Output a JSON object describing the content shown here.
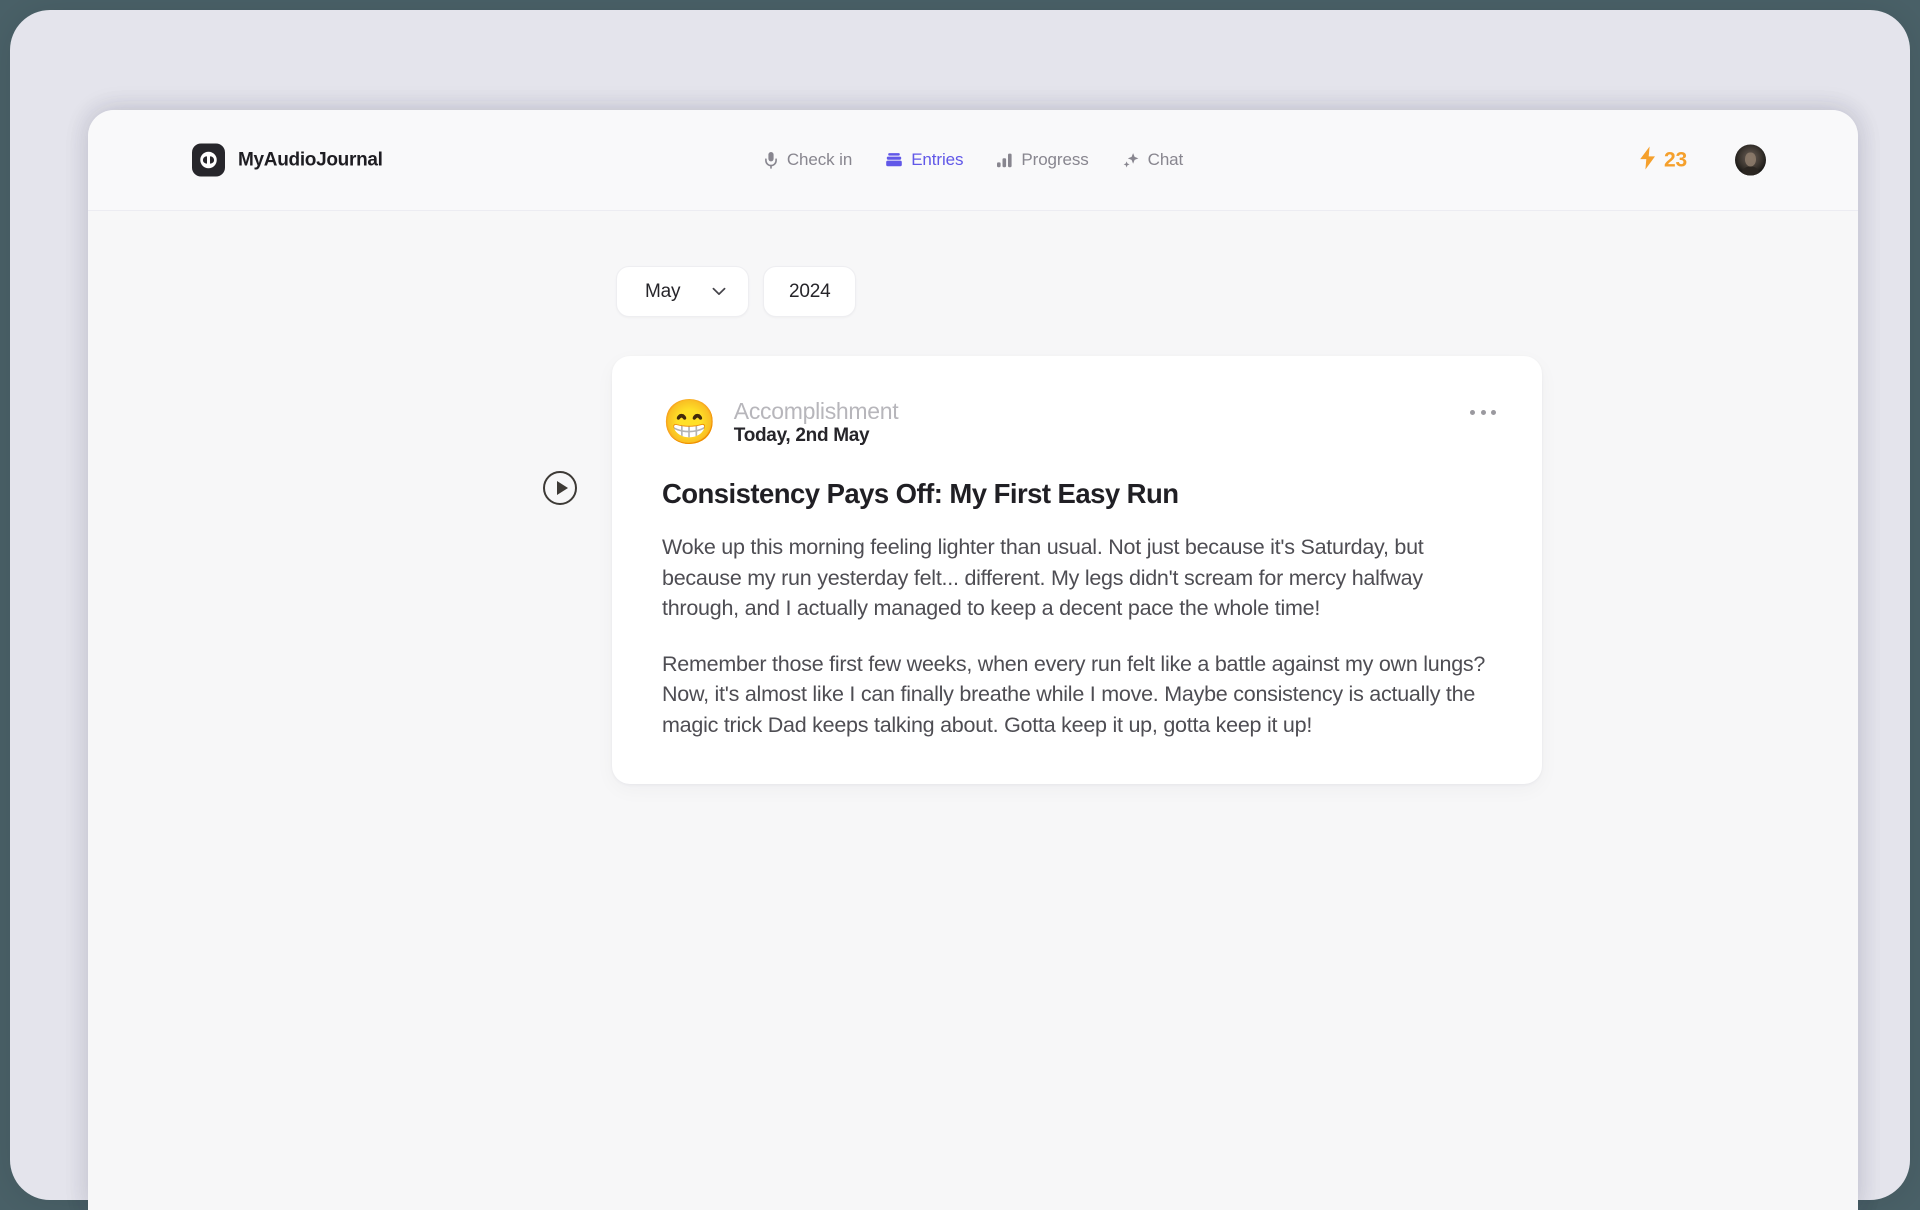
{
  "brand": {
    "name": "MyAudioJournal",
    "logo_icon": "audio-journal-logo-icon"
  },
  "nav": {
    "items": [
      {
        "label": "Check in",
        "icon": "microphone-icon",
        "active": false
      },
      {
        "label": "Entries",
        "icon": "book-stack-icon",
        "active": true
      },
      {
        "label": "Progress",
        "icon": "bar-chart-icon",
        "active": false
      },
      {
        "label": "Chat",
        "icon": "sparkles-icon",
        "active": false
      }
    ]
  },
  "topbar_right": {
    "streak_icon": "lightning-bolt-icon",
    "streak_count": "23",
    "avatar_icon": "user-avatar"
  },
  "filters": {
    "month": "May",
    "month_chevron_icon": "chevron-down-icon",
    "year": "2024"
  },
  "entry": {
    "play_icon": "play-circle-icon",
    "mood_emoji": "😁",
    "category": "Accomplishment",
    "date": "Today, 2nd May",
    "menu_icon": "ellipsis-horizontal-icon",
    "title": "Consistency Pays Off: My First Easy Run",
    "paragraphs": [
      "Woke up this morning feeling lighter than usual. Not just because it's Saturday, but because my run yesterday felt... different. My legs didn't scream for mercy halfway through, and I actually managed to keep a decent pace the whole time!",
      "Remember those first few weeks, when every run felt like a battle against my own lungs? Now, it's almost like I can finally breathe while I move. Maybe consistency is actually the magic trick Dad keeps talking about. Gotta keep it up, gotta keep it up!"
    ]
  },
  "colors": {
    "accent_purple": "#6158e8",
    "streak_orange": "#f5a02c",
    "page_background": "#f7f7f8",
    "shell_background": "#e4e4ec",
    "desktop_background": "#4a6168"
  }
}
